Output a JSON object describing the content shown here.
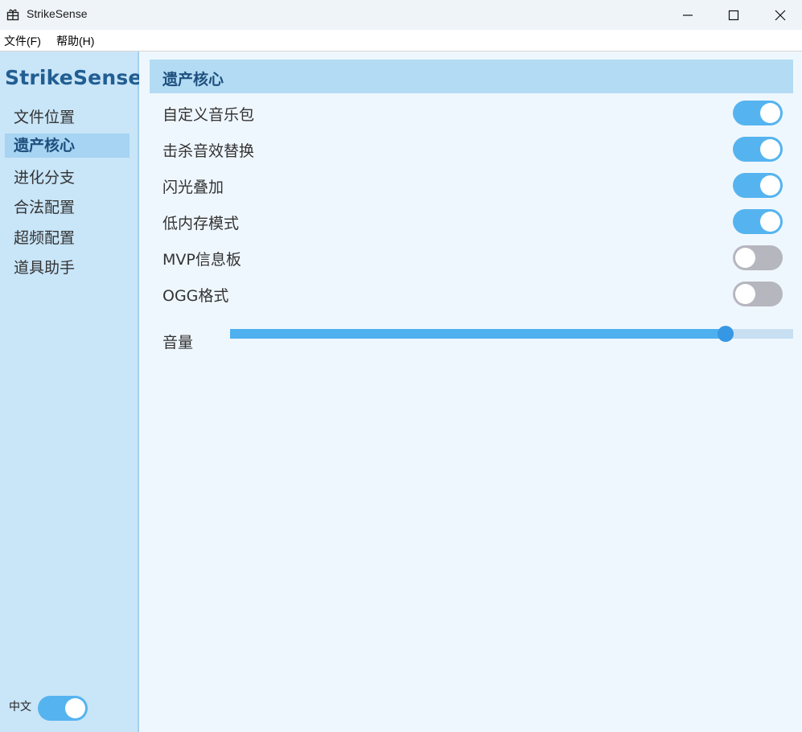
{
  "window": {
    "title": "StrikeSense",
    "icon": "gift-icon"
  },
  "menu": {
    "file": "文件(F)",
    "help": "帮助(H)"
  },
  "sidebar": {
    "brand": "StrikeSense",
    "items": [
      {
        "label": "文件位置",
        "active": false
      },
      {
        "label": "遗产核心",
        "active": true
      },
      {
        "label": "进化分支",
        "active": false
      },
      {
        "label": "合法配置",
        "active": false
      },
      {
        "label": "超频配置",
        "active": false
      },
      {
        "label": "道具助手",
        "active": false
      }
    ],
    "language_label": "中文",
    "language_toggle_on": true
  },
  "main": {
    "section_title": "遗产核心",
    "settings": [
      {
        "label": "自定义音乐包",
        "on": true
      },
      {
        "label": "击杀音效替换",
        "on": true
      },
      {
        "label": "闪光叠加",
        "on": true
      },
      {
        "label": "低内存模式",
        "on": true
      },
      {
        "label": "MVP信息板",
        "on": false
      },
      {
        "label": "OGG格式",
        "on": false
      }
    ],
    "volume": {
      "label": "音量",
      "value_percent": 88
    }
  },
  "colors": {
    "accent": "#55b4ef",
    "toggle_off": "#b6b6bf",
    "sidebar_bg": "#c9e5f8",
    "header_bg": "#b3dcf4",
    "brand_text": "#215e92"
  }
}
